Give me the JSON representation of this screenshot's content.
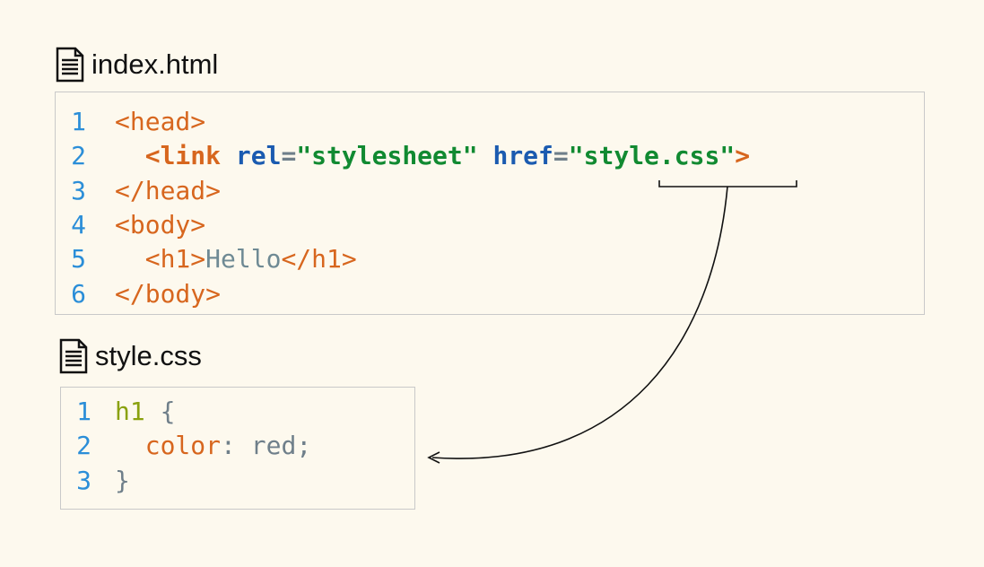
{
  "files": [
    {
      "name": "index.html",
      "lines": [
        {
          "num": "1",
          "indent": "",
          "tokens": [
            {
              "t": "<head>",
              "k": "tag"
            }
          ]
        },
        {
          "num": "2",
          "indent": "  ",
          "tokens": [
            {
              "t": "<link",
              "k": "tagb"
            },
            {
              "t": " ",
              "k": "sp"
            },
            {
              "t": "rel",
              "k": "attr"
            },
            {
              "t": "=",
              "k": "eq"
            },
            {
              "t": "\"stylesheet\"",
              "k": "val"
            },
            {
              "t": " ",
              "k": "sp"
            },
            {
              "t": "href",
              "k": "attr"
            },
            {
              "t": "=",
              "k": "eq"
            },
            {
              "t": "\"style.css\"",
              "k": "val"
            },
            {
              "t": ">",
              "k": "tagb"
            }
          ]
        },
        {
          "num": "3",
          "indent": "",
          "tokens": [
            {
              "t": "</head>",
              "k": "tag"
            }
          ]
        },
        {
          "num": "4",
          "indent": "",
          "tokens": [
            {
              "t": "<body>",
              "k": "tag"
            }
          ]
        },
        {
          "num": "5",
          "indent": "  ",
          "tokens": [
            {
              "t": "<h1>",
              "k": "tag"
            },
            {
              "t": "Hello",
              "k": "txt"
            },
            {
              "t": "</h1>",
              "k": "tag"
            }
          ]
        },
        {
          "num": "6",
          "indent": "",
          "tokens": [
            {
              "t": "</body>",
              "k": "tag"
            }
          ]
        }
      ]
    },
    {
      "name": "style.css",
      "lines": [
        {
          "num": "1",
          "indent": "",
          "tokens": [
            {
              "t": "h1",
              "k": "sel"
            },
            {
              "t": " {",
              "k": "punc"
            }
          ]
        },
        {
          "num": "2",
          "indent": "  ",
          "tokens": [
            {
              "t": "color",
              "k": "prop"
            },
            {
              "t": ": ",
              "k": "punc"
            },
            {
              "t": "red",
              "k": "cval"
            },
            {
              "t": ";",
              "k": "punc"
            }
          ]
        },
        {
          "num": "3",
          "indent": "",
          "tokens": [
            {
              "t": "}",
              "k": "punc"
            }
          ]
        }
      ]
    }
  ],
  "icons": {
    "file": "document-icon"
  }
}
